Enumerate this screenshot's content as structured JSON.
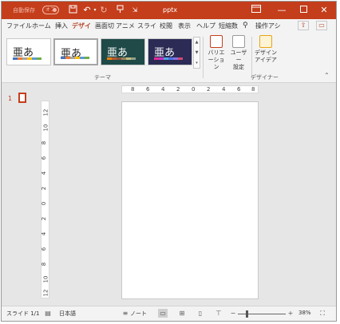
{
  "titlebar": {
    "autosave_label": "自動保存",
    "autosave_state": "オフ",
    "title": "pptx",
    "icons": [
      "save-icon",
      "undo-icon",
      "redo-icon",
      "pin-icon",
      "customize-icon"
    ],
    "window_controls": [
      "ribbon-display-icon",
      "minimize-icon",
      "maximize-icon",
      "close-icon"
    ]
  },
  "tabs": [
    {
      "label": "ファイル"
    },
    {
      "label": "ホーム"
    },
    {
      "label": "挿入"
    },
    {
      "label": "デザイ"
    },
    {
      "label": "画面切"
    },
    {
      "label": "アニメ"
    },
    {
      "label": "スライド"
    },
    {
      "label": "校閲"
    },
    {
      "label": "表示"
    },
    {
      "label": "ヘルプ"
    },
    {
      "label": "短縮数"
    },
    {
      "label": "操作アシ"
    }
  ],
  "active_tab": "デザイ",
  "ribbon": {
    "themes": [
      {
        "text": "亜あ",
        "bg": "#ffffff",
        "fg": "#222222",
        "selected": false
      },
      {
        "text": "亜あ",
        "bg": "#ffffff",
        "fg": "#222222",
        "selected": true
      },
      {
        "text": "亜あ",
        "bg": "#1f4a48",
        "fg": "#ffffff",
        "selected": false
      },
      {
        "text": "亜あ",
        "bg": "#2b2b55",
        "fg": "#ffffff",
        "selected": false
      }
    ],
    "theme_group_label": "テーマ",
    "variation_label": "バリエ",
    "variation_label2": "ーション",
    "user_label": "ユーザー",
    "user_label2": "設定",
    "design_idea_label": "デザイン",
    "design_idea_label2": "アイデア",
    "designer_group_label": "デザイナー"
  },
  "thumbnails": {
    "slide_number": "1"
  },
  "ruler": {
    "horizontal": [
      "8",
      "6",
      "4",
      "2",
      "0",
      "2",
      "4",
      "6",
      "8"
    ],
    "vertical": [
      "12",
      "10",
      "8",
      "6",
      "4",
      "2",
      "0",
      "2",
      "4",
      "6",
      "8",
      "10",
      "12"
    ]
  },
  "status": {
    "slide_count": "スライド 1/1",
    "language": "日本語",
    "notes_label": "ノート",
    "zoom": "38%"
  },
  "colors": {
    "accent": "#c43e1c",
    "tab_accent": "#b7472a"
  }
}
